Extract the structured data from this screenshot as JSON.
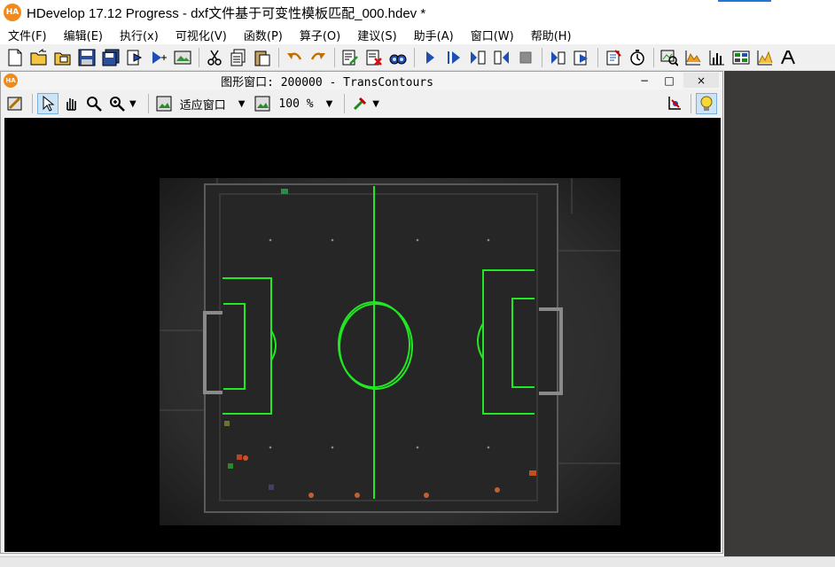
{
  "app": {
    "title": "HDevelop 17.12 Progress - dxf文件基于可变性模板匹配_000.hdev *",
    "logo_text": "HA",
    "accent_color": "#f08a1c"
  },
  "menu": {
    "items": [
      {
        "label": "文件(F)"
      },
      {
        "label": "编辑(E)"
      },
      {
        "label": "执行(x)"
      },
      {
        "label": "可视化(V)"
      },
      {
        "label": "函数(P)"
      },
      {
        "label": "算子(O)"
      },
      {
        "label": "建议(S)"
      },
      {
        "label": "助手(A)"
      },
      {
        "label": "窗口(W)"
      },
      {
        "label": "帮助(H)"
      }
    ]
  },
  "toolbar": {
    "icons": [
      "new-file-icon",
      "open-file-icon",
      "export-icon",
      "save-icon",
      "save-all-icon",
      "insert-icon",
      "run-to-icon",
      "image-tool-icon",
      "cut-icon",
      "copy-icon",
      "paste-icon",
      "undo-icon",
      "redo-icon",
      "edit-line-icon",
      "delete-line-icon",
      "find-icon",
      "run-icon",
      "step-over-icon",
      "step-into-icon",
      "step-out-icon",
      "stop-icon",
      "reset-icon",
      "reset-program-icon",
      "profile-icon",
      "timer-icon",
      "zoom-window-icon",
      "line-profile-icon",
      "histogram-icon",
      "variable-inspect-icon",
      "gray-histogram-icon",
      "more-icon"
    ]
  },
  "graphics_window": {
    "title": "图形窗口: 200000 - TransContours",
    "logo_text": "HA",
    "minimize": "−",
    "maximize": "□",
    "close": "×",
    "fit_label": "适应窗口",
    "zoom_label": "100 %",
    "contour_color": "#22e822"
  }
}
